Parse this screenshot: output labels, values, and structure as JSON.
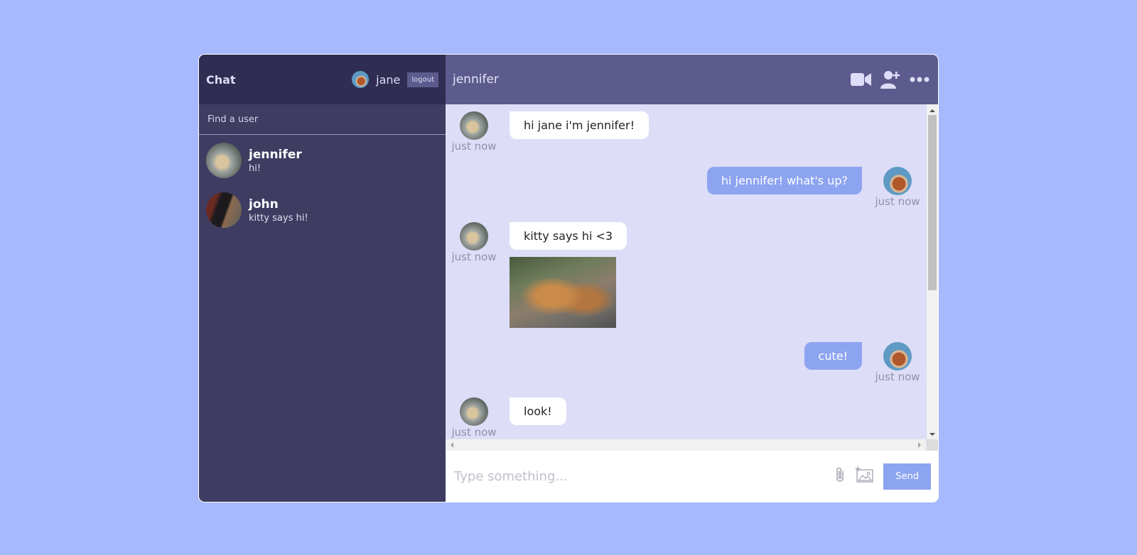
{
  "sidebar": {
    "logo": "Chat",
    "current_user": {
      "name": "jane",
      "avatar_icon": "avatar-jane"
    },
    "logout_label": "logout",
    "search_placeholder": "Find a user",
    "chats": [
      {
        "name": "jennifer",
        "last_message": "hi!",
        "avatar_icon": "avatar-jennifer"
      },
      {
        "name": "john",
        "last_message": "kitty says hi!",
        "avatar_icon": "avatar-john"
      }
    ]
  },
  "chat": {
    "title": "jennifer",
    "header_icons": [
      "video-camera-icon",
      "add-user-icon",
      "more-icon"
    ],
    "messages": [
      {
        "owner": false,
        "text": "hi jane i'm jennifer!",
        "time": "just now"
      },
      {
        "owner": true,
        "text": "hi jennifer! what's up?",
        "time": "just now"
      },
      {
        "owner": false,
        "text": "kitty says hi <3",
        "time": "just now",
        "has_image": true
      },
      {
        "owner": true,
        "text": "cute!",
        "time": "just now"
      },
      {
        "owner": false,
        "text": "look!",
        "time": "just now"
      }
    ],
    "input_placeholder": "Type something...",
    "send_label": "Send",
    "input_icons": [
      "paperclip-icon",
      "add-image-icon"
    ]
  },
  "colors": {
    "page_bg": "#a7b9fd",
    "sidebar_bg": "#3e3c61",
    "sidebar_header_bg": "#2f2d52",
    "chat_header_bg": "#5d5b8d",
    "messages_bg": "#ddddf7",
    "owner_bubble": "#8da4f1"
  }
}
